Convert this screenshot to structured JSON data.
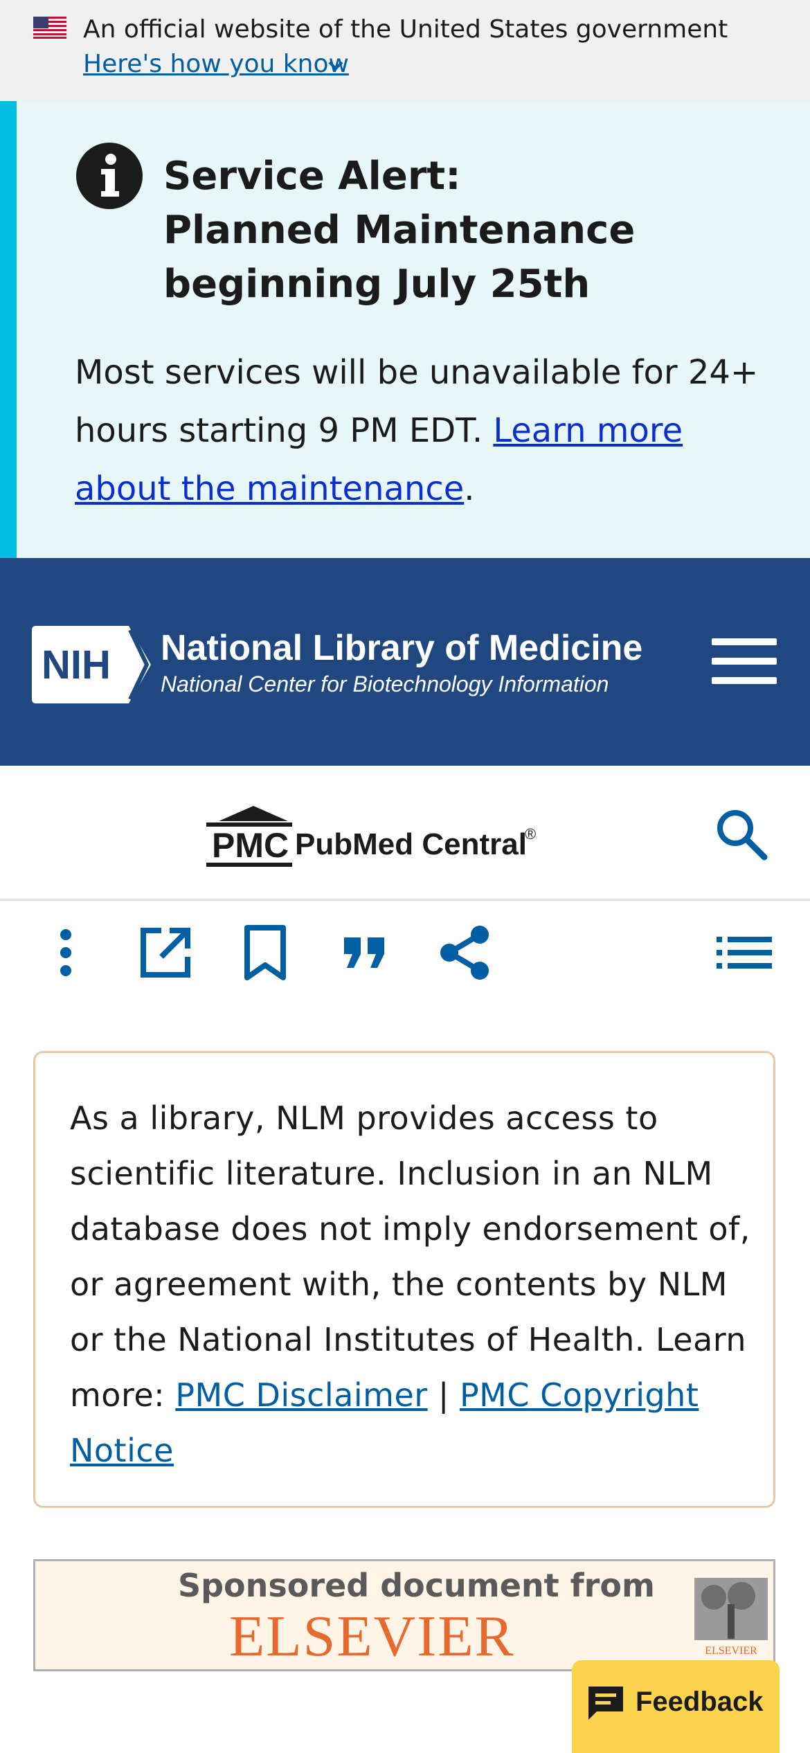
{
  "gov_banner": {
    "text": "An official website of the United States government",
    "link": "Here's how you know"
  },
  "alert": {
    "title": "Service Alert: Planned Maintenance beginning July 25th",
    "body": "Most services will be unavailable for 24+ hours starting 9 PM EDT.",
    "link": "Learn more about the maintenance",
    "end": "."
  },
  "nih": {
    "logo_text": "NIH",
    "title": "National Library of Medicine",
    "subtitle": "National Center for Biotechnology Information"
  },
  "pmc": {
    "logo_text": "PMC",
    "name": "PubMed Central",
    "reg": "®"
  },
  "toolbar": {
    "icons": [
      "more-icon",
      "open-external-icon",
      "bookmark-icon",
      "cite-icon",
      "share-icon",
      "contents-list-icon"
    ]
  },
  "disclaimer": {
    "text": "As a library, NLM provides access to scientific literature. Inclusion in an NLM database does not imply endorsement of, or agreement with, the contents by NLM or the National Institutes of Health.",
    "learn_more": "Learn more:",
    "link1": "PMC Disclaimer",
    "separator": "|",
    "link2": "PMC Copyright Notice"
  },
  "sponsored": {
    "from": "Sponsored document from",
    "publisher": "ELSEVIER",
    "logo_caption": "ELSEVIER"
  },
  "feedback": {
    "label": "Feedback"
  },
  "colors": {
    "nih_blue": "#20477f",
    "alert_bg": "#e7f6f8",
    "alert_bar": "#00bde3",
    "link_blue": "#005ea2",
    "feedback_yellow": "#fcd34d",
    "elsevier_orange": "#e6692d"
  }
}
